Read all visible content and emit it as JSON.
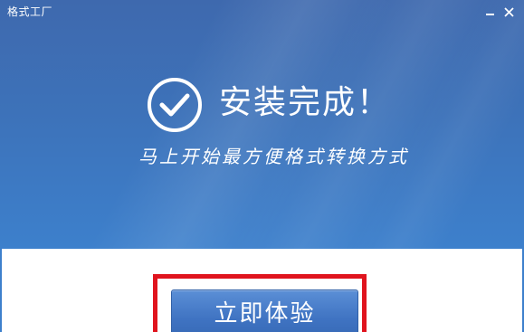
{
  "window": {
    "title": "格式工厂"
  },
  "hero": {
    "headline": "安装完成！",
    "subtitle": "马上开始最方便格式转换方式"
  },
  "actions": {
    "primary_label": "立即体验"
  },
  "icons": {
    "status": "check-circle-icon",
    "minimize": "minimize-icon",
    "close": "close-icon"
  },
  "colors": {
    "header_blue": "#3d72b9",
    "highlight_red": "#e0141e",
    "button_blue": "#3f73c2"
  }
}
